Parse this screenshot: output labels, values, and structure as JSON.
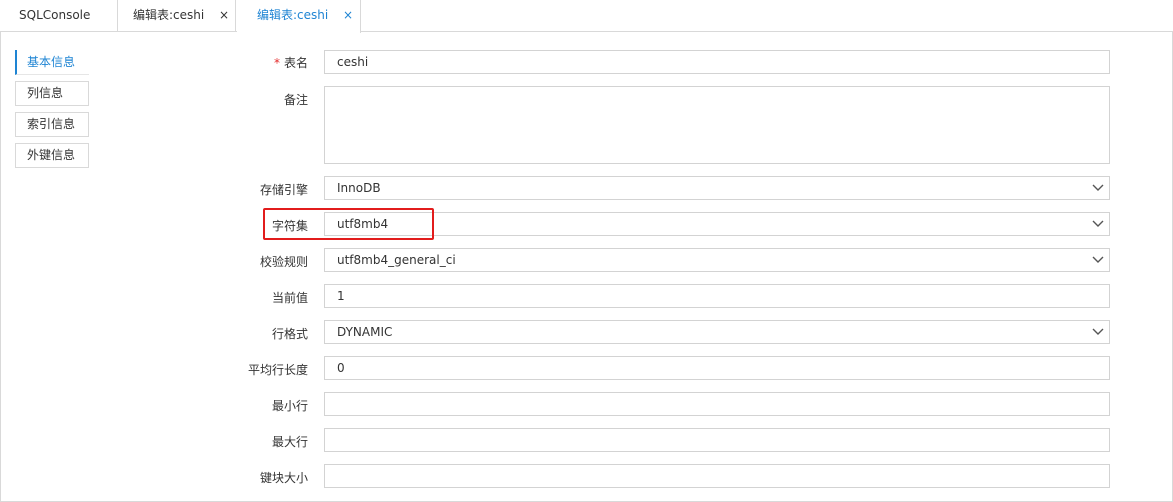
{
  "tabs": [
    {
      "label": "SQLConsole",
      "closable": false,
      "active": false
    },
    {
      "label": "编辑表:ceshi",
      "closable": true,
      "active": false
    },
    {
      "label": "编辑表:ceshi",
      "closable": true,
      "active": true
    }
  ],
  "close_glyph": "×",
  "sidebar": {
    "items": [
      {
        "label": "基本信息",
        "active": true
      },
      {
        "label": "列信息",
        "active": false
      },
      {
        "label": "索引信息",
        "active": false
      },
      {
        "label": "外键信息",
        "active": false
      }
    ]
  },
  "form": {
    "required_mark": "*",
    "table_name": {
      "label": "表名",
      "value": "ceshi"
    },
    "comment": {
      "label": "备注",
      "value": ""
    },
    "engine": {
      "label": "存储引擎",
      "value": "InnoDB"
    },
    "charset": {
      "label": "字符集",
      "value": "utf8mb4"
    },
    "collation": {
      "label": "校验规则",
      "value": "utf8mb4_general_ci"
    },
    "auto_increment": {
      "label": "当前值",
      "value": "1"
    },
    "row_format": {
      "label": "行格式",
      "value": "DYNAMIC"
    },
    "avg_row_length": {
      "label": "平均行长度",
      "value": "0"
    },
    "min_rows": {
      "label": "最小行",
      "value": ""
    },
    "max_rows": {
      "label": "最大行",
      "value": ""
    },
    "key_block_size": {
      "label": "键块大小",
      "value": ""
    }
  },
  "colors": {
    "accent": "#1e84d3",
    "highlight": "#e21c1c",
    "required": "#e42b2b"
  }
}
